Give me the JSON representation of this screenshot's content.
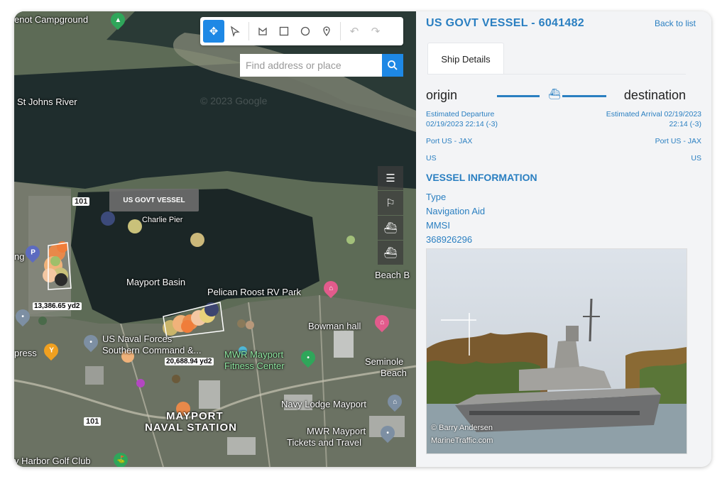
{
  "map": {
    "watermark": "© 2023 Google",
    "search_placeholder": "Find address or place",
    "tooltip": "US GOVT VESSEL",
    "measure_1": "13,386.65 yd2",
    "measure_2": "20,688.94 yd2",
    "labels": {
      "campground": "enot Campground",
      "river": "St Johns River",
      "charlie_pier": "Charlie Pier",
      "basin": "Mayport Basin",
      "pelican": "Pelican Roost RV Park",
      "bowman": "Bowman hall",
      "naval_forces": "US Naval Forces",
      "southern_command": "Southern Command &...",
      "mwr_fitness_1": "MWR Mayport",
      "mwr_fitness_2": "Fitness Center",
      "seminole_1": "Seminole",
      "seminole_2": "Beach",
      "navy_lodge": "Navy Lodge Mayport",
      "mayport_1": "MAYPORT",
      "mayport_2": "NAVAL STATION",
      "mwr_tickets_1": "MWR Mayport",
      "mwr_tickets_2": "Tickets and Travel",
      "golf": "y Harbor Golf Club",
      "express": "press",
      "beach_b": "Beach B",
      "road_101_a": "101",
      "road_101_b": "101",
      "map_ng": "ng"
    },
    "toolbar_icons": [
      "move-icon",
      "select-arrow-icon",
      "polygon-icon",
      "rectangle-icon",
      "circle-icon",
      "marker-icon",
      "undo-icon",
      "redo-icon"
    ],
    "side_icons": [
      "list-icon",
      "flag-icon",
      "ship-filter-icon",
      "vessel-icon"
    ]
  },
  "panel": {
    "title": "US GOVT VESSEL - 6041482",
    "back_label": "Back to list",
    "tab_label": "Ship Details",
    "origin_label": "origin",
    "destination_label": "destination",
    "est_departure_label": "Estimated Departure",
    "est_departure_time": "02/19/2023 22:14 (-3)",
    "est_arrival_line1": "Estimated Arrival 02/19/2023",
    "est_arrival_line2": "22:14 (-3)",
    "origin_port": "Port US - JAX",
    "dest_port": "Port US - JAX",
    "origin_country": "US",
    "dest_country": "US",
    "vessel_info_heading": "VESSEL INFORMATION",
    "type_label": "Type",
    "type_value": "Navigation Aid",
    "mmsi_label": "MMSI",
    "mmsi_value": "368926296",
    "photo_credit_1": "© Barry Andersen",
    "photo_credit_2": "MarineTraffic.com"
  },
  "colors": {
    "accent": "#2a7fc1",
    "toolbar_active": "#1e88e5"
  }
}
